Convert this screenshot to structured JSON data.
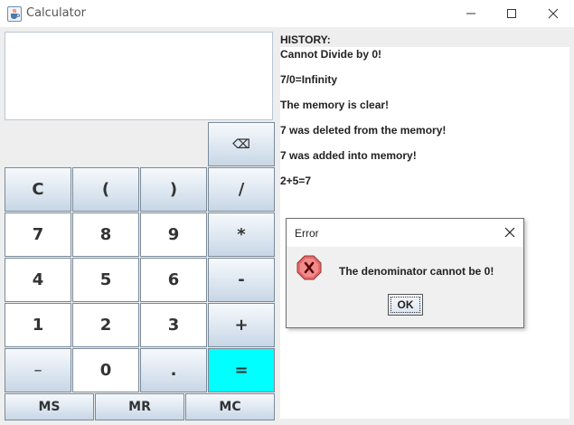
{
  "window": {
    "title": "Calculator",
    "icon": "java-cup-icon",
    "controls": [
      "minimize-icon",
      "maximize-icon",
      "close-icon"
    ]
  },
  "display": {
    "value": ""
  },
  "keys": {
    "backspace": "⌫",
    "clear": "C",
    "open_paren": "(",
    "close_paren": ")",
    "divide": "/",
    "seven": "7",
    "eight": "8",
    "nine": "9",
    "multiply": "*",
    "four": "4",
    "five": "5",
    "six": "6",
    "minus": "-",
    "one": "1",
    "two": "2",
    "three": "3",
    "plus": "+",
    "negate": "–",
    "zero": "0",
    "decimal": ".",
    "equals": "=",
    "memory_store": "MS",
    "memory_recall": "MR",
    "memory_clear": "MC"
  },
  "history": {
    "heading": "HISTORY:",
    "lines": [
      "Cannot Divide by 0!",
      "7/0=Infinity",
      "The memory is clear!",
      "7 was deleted from the memory!",
      "7 was added into memory!",
      "2+5=7"
    ]
  },
  "dialog": {
    "title": "Error",
    "message": "The denominator cannot be 0!",
    "ok_label": "OK",
    "icon": "error-icon"
  },
  "colors": {
    "equals_key": "#00ffff",
    "error_icon": "#e46a6a"
  }
}
